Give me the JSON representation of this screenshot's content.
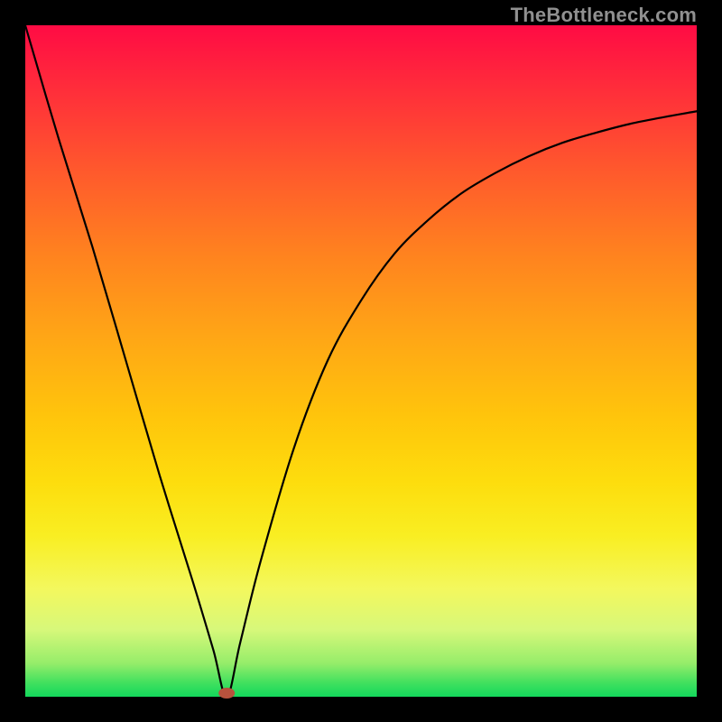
{
  "watermark": "TheBottleneck.com",
  "chart_data": {
    "type": "line",
    "title": "",
    "xlabel": "",
    "ylabel": "",
    "xlim": [
      0,
      100
    ],
    "ylim": [
      0,
      100
    ],
    "grid": false,
    "legend": false,
    "notch_x": 30,
    "series": [
      {
        "name": "curve",
        "x": [
          0,
          5,
          10,
          15,
          20,
          25,
          28,
          30,
          32,
          35,
          40,
          45,
          50,
          55,
          60,
          65,
          70,
          75,
          80,
          85,
          90,
          95,
          100
        ],
        "y": [
          100,
          83,
          67,
          50,
          33,
          17,
          7,
          0,
          8,
          20,
          37,
          50,
          59,
          66,
          71,
          75,
          78,
          80.5,
          82.5,
          84,
          85.3,
          86.3,
          87.2
        ]
      }
    ]
  }
}
